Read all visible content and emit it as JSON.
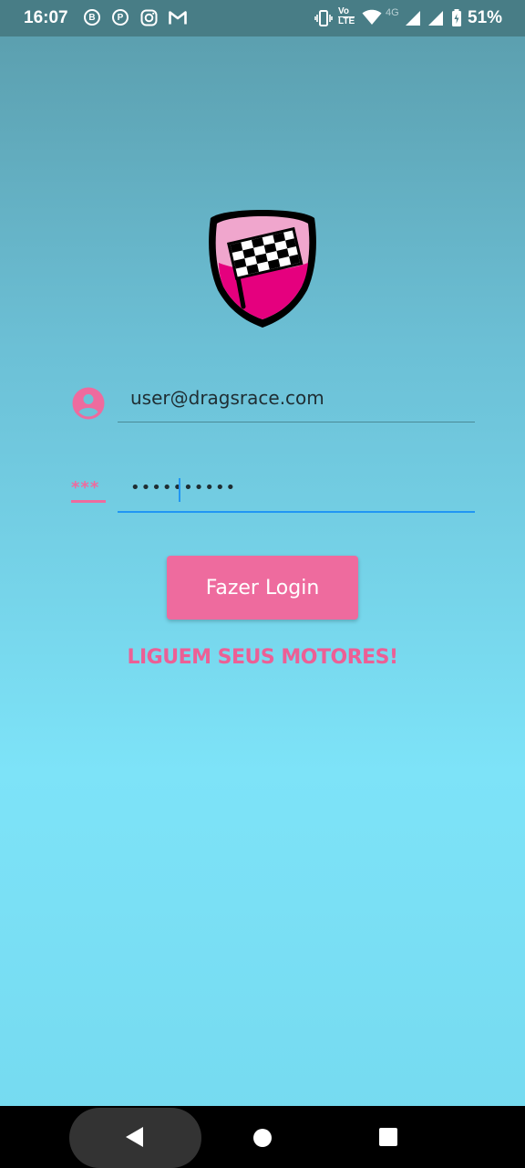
{
  "status_bar": {
    "time": "16:07",
    "notification_icons": [
      "whatsapp-business-icon",
      "p-app-icon",
      "instagram-icon",
      "gmail-icon"
    ],
    "vo_lte_top": "Vo",
    "vo_lte_bottom": "LTE",
    "network_type": "4G",
    "battery_percent": "51%"
  },
  "logo": {
    "name": "checkered-flag-shield-logo"
  },
  "login_form": {
    "email_value": "user@dragsrace.com",
    "password_masked": "••••••••••",
    "password_icon_text": "***"
  },
  "login_button": {
    "label": "Fazer Login"
  },
  "tagline": "LIGUEM SEUS MOTORES!",
  "colors": {
    "accent_pink": "#ee6b9e",
    "focus_blue": "#2196f3",
    "status_bar_bg": "#487d86"
  }
}
